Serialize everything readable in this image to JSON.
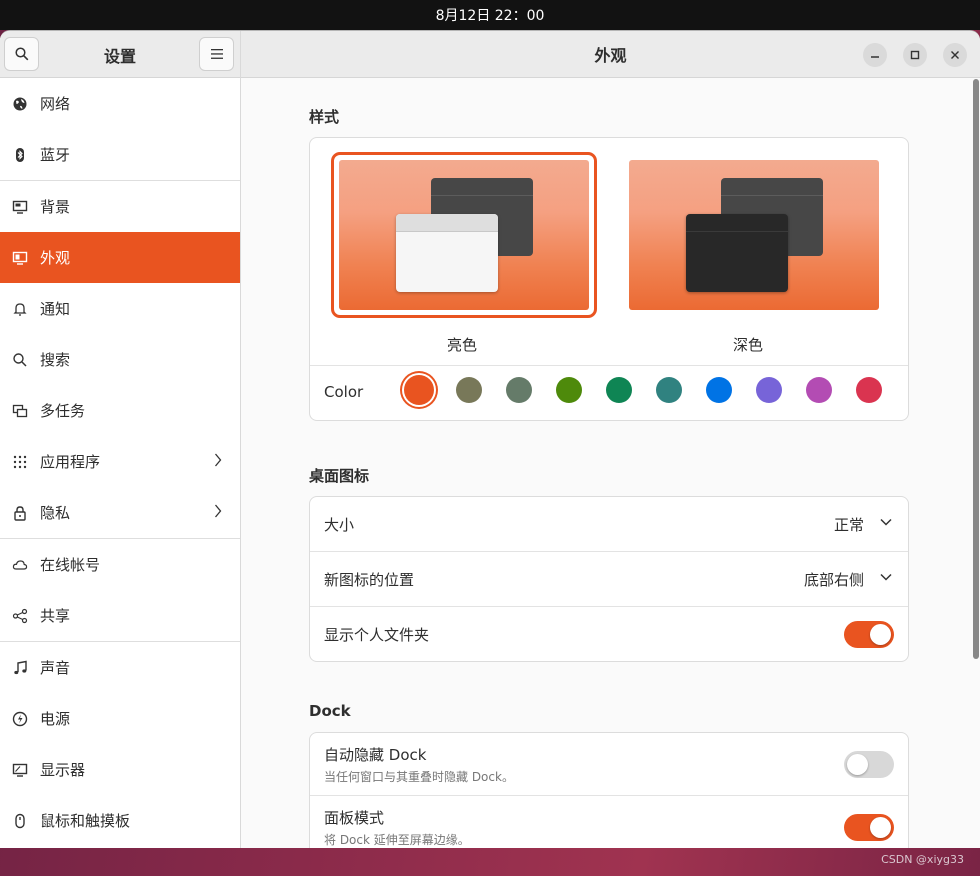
{
  "topbar": {
    "clock": "8月12日  22：00"
  },
  "sidebar": {
    "title": "设置",
    "groups": [
      [
        {
          "label": "网络",
          "icon": "globe-icon"
        },
        {
          "label": "蓝牙",
          "icon": "bluetooth-icon"
        }
      ],
      [
        {
          "label": "背景",
          "icon": "monitor-icon"
        },
        {
          "label": "外观",
          "icon": "appearance-icon"
        },
        {
          "label": "通知",
          "icon": "bell-icon"
        },
        {
          "label": "搜索",
          "icon": "search-icon"
        },
        {
          "label": "多任务",
          "icon": "multitask-icon"
        },
        {
          "label": "应用程序",
          "icon": "apps-grid-icon"
        },
        {
          "label": "隐私",
          "icon": "lock-icon"
        }
      ],
      [
        {
          "label": "在线帐号",
          "icon": "cloud-icon"
        },
        {
          "label": "共享",
          "icon": "share-icon"
        }
      ],
      [
        {
          "label": "声音",
          "icon": "music-note-icon"
        },
        {
          "label": "电源",
          "icon": "power-icon"
        },
        {
          "label": "显示器",
          "icon": "display-icon"
        },
        {
          "label": "鼠标和触摸板",
          "icon": "mouse-icon"
        }
      ]
    ],
    "active": "外观"
  },
  "main": {
    "title": "外观",
    "style_section": {
      "title": "样式",
      "light_label": "亮色",
      "dark_label": "深色",
      "color_label": "Color",
      "colors": [
        "#e95420",
        "#787859",
        "#657b69",
        "#4e8a0b",
        "#0f8554",
        "#308280",
        "#0073e5",
        "#7764d8",
        "#b34cb3",
        "#da3450"
      ],
      "selected_color": "#e95420"
    },
    "desktop_icons": {
      "title": "桌面图标",
      "size_label": "大小",
      "size_value": "正常",
      "position_label": "新图标的位置",
      "position_value": "底部右侧",
      "home_label": "显示个人文件夹",
      "home_on": true
    },
    "dock": {
      "title": "Dock",
      "autohide_label": "自动隐藏 Dock",
      "autohide_desc": "当任何窗口与其重叠时隐藏 Dock。",
      "autohide_on": false,
      "panel_label": "面板模式",
      "panel_desc": "将 Dock 延伸至屏幕边缘。",
      "panel_on": true
    }
  },
  "watermark": "CSDN @xiyg33"
}
